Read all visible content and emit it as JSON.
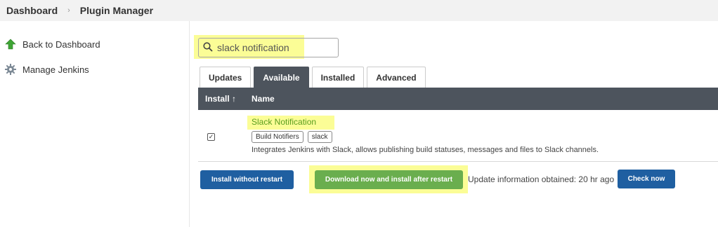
{
  "breadcrumb": {
    "home": "Dashboard",
    "separator": "›",
    "current": "Plugin Manager"
  },
  "sidebar": {
    "items": [
      {
        "label": "Back to Dashboard",
        "icon": "up-arrow-icon"
      },
      {
        "label": "Manage Jenkins",
        "icon": "gear-icon"
      }
    ]
  },
  "search": {
    "value": "slack notification",
    "icon": "search-icon"
  },
  "tabs": [
    {
      "label": "Updates",
      "active": false
    },
    {
      "label": "Available",
      "active": true
    },
    {
      "label": "Installed",
      "active": false
    },
    {
      "label": "Advanced",
      "active": false
    }
  ],
  "table": {
    "headers": {
      "install": "Install ↑",
      "name": "Name"
    },
    "rows": [
      {
        "checked": true,
        "checkmark": "✓",
        "name": "Slack Notification",
        "tags": [
          "Build Notifiers",
          "slack"
        ],
        "description": "Integrates Jenkins with Slack, allows publishing build statuses, messages and files to Slack channels."
      }
    ]
  },
  "actions": {
    "install_without_restart": "Install without restart",
    "download_install_after_restart": "Download now and install after restart",
    "update_info": "Update information obtained: 20 hr ago",
    "check_now": "Check now"
  },
  "colors": {
    "header_bg": "#4d545d",
    "primary_button": "#1f5fa1",
    "green_button": "#6aae4e",
    "highlight": "#fbfd96",
    "link_green": "#5a9e1e"
  }
}
